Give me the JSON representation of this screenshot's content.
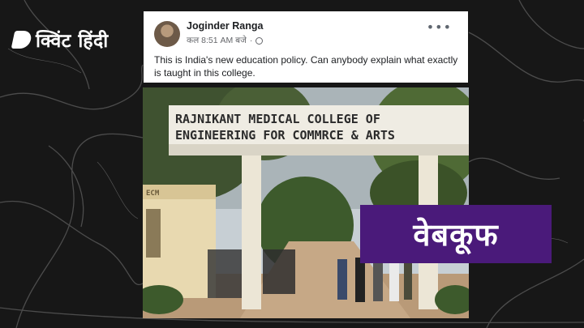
{
  "brand": {
    "name": "क्विंट हिंदी",
    "icon": "quint-logo-icon"
  },
  "post": {
    "author": "Joginder Ranga",
    "time": "कल 8:51 AM बजे",
    "privacy_icon": "globe-icon",
    "menu_icon": "more-options-icon",
    "text": "This is India's new education policy. Can anybody explain what exactly is taught in this college."
  },
  "photo": {
    "sign_line1": "RAJNIKANT MEDICAL COLLEGE OF",
    "sign_line2": "ENGINEERING FOR COMMRCE & ARTS",
    "gate_label": "ECM"
  },
  "stamp": {
    "label": "वेबकूफ",
    "color": "#4a1a7a"
  }
}
